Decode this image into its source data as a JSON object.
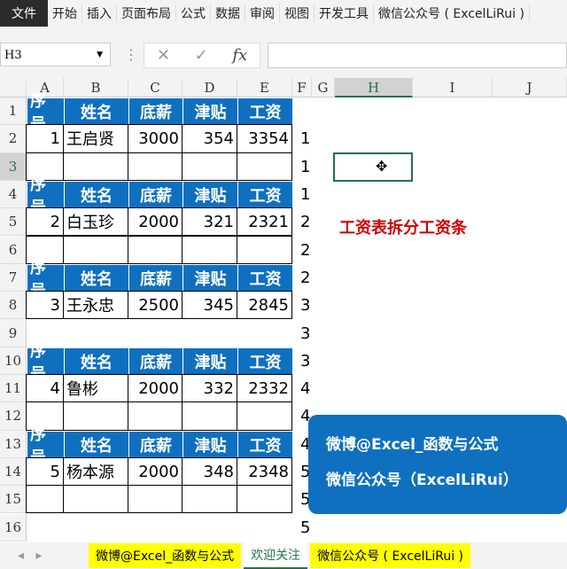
{
  "ribbon": {
    "file": "文件",
    "tabs": [
      "开始",
      "插入",
      "页面布局",
      "公式",
      "数据",
      "审阅",
      "视图",
      "开发工具",
      "微信公众号 ( ExcelLiRui )"
    ]
  },
  "formula_bar": {
    "name_box": "H3",
    "cancel": "✕",
    "enter": "✓",
    "fx": "fx",
    "value": ""
  },
  "columns": [
    "A",
    "B",
    "C",
    "D",
    "E",
    "F",
    "G",
    "H",
    "I",
    "J"
  ],
  "rows": [
    "1",
    "2",
    "3",
    "4",
    "5",
    "6",
    "7",
    "8",
    "9",
    "10",
    "11",
    "12",
    "13",
    "14",
    "15",
    "16"
  ],
  "header": [
    "序号",
    "姓名",
    "底薪",
    "津贴",
    "工资"
  ],
  "records": [
    [
      "1",
      "王启贤",
      "3000",
      "354",
      "3354"
    ],
    [
      "2",
      "白玉珍",
      "2000",
      "321",
      "2321"
    ],
    [
      "3",
      "王永忠",
      "2500",
      "345",
      "2845"
    ],
    [
      "4",
      "鲁彬",
      "2000",
      "332",
      "2332"
    ],
    [
      "5",
      "杨本源",
      "2000",
      "348",
      "2348"
    ]
  ],
  "col_f": [
    "1",
    "1",
    "1",
    "2",
    "2",
    "2",
    "3",
    "3",
    "3",
    "4",
    "4",
    "4",
    "5",
    "5",
    "5"
  ],
  "note": "工资表拆分工资条",
  "promo": [
    "微博@Excel_函数与公式",
    "微信公众号（ExcelLiRui）"
  ],
  "sheet_tabs": [
    "微博@Excel_函数与公式",
    "欢迎关注",
    "微信公众号 ( ExcelLiRui )"
  ],
  "colors": {
    "header_blue": "#0f70c0",
    "note_red": "#d00000",
    "tab_yellow": "#ffff00"
  }
}
